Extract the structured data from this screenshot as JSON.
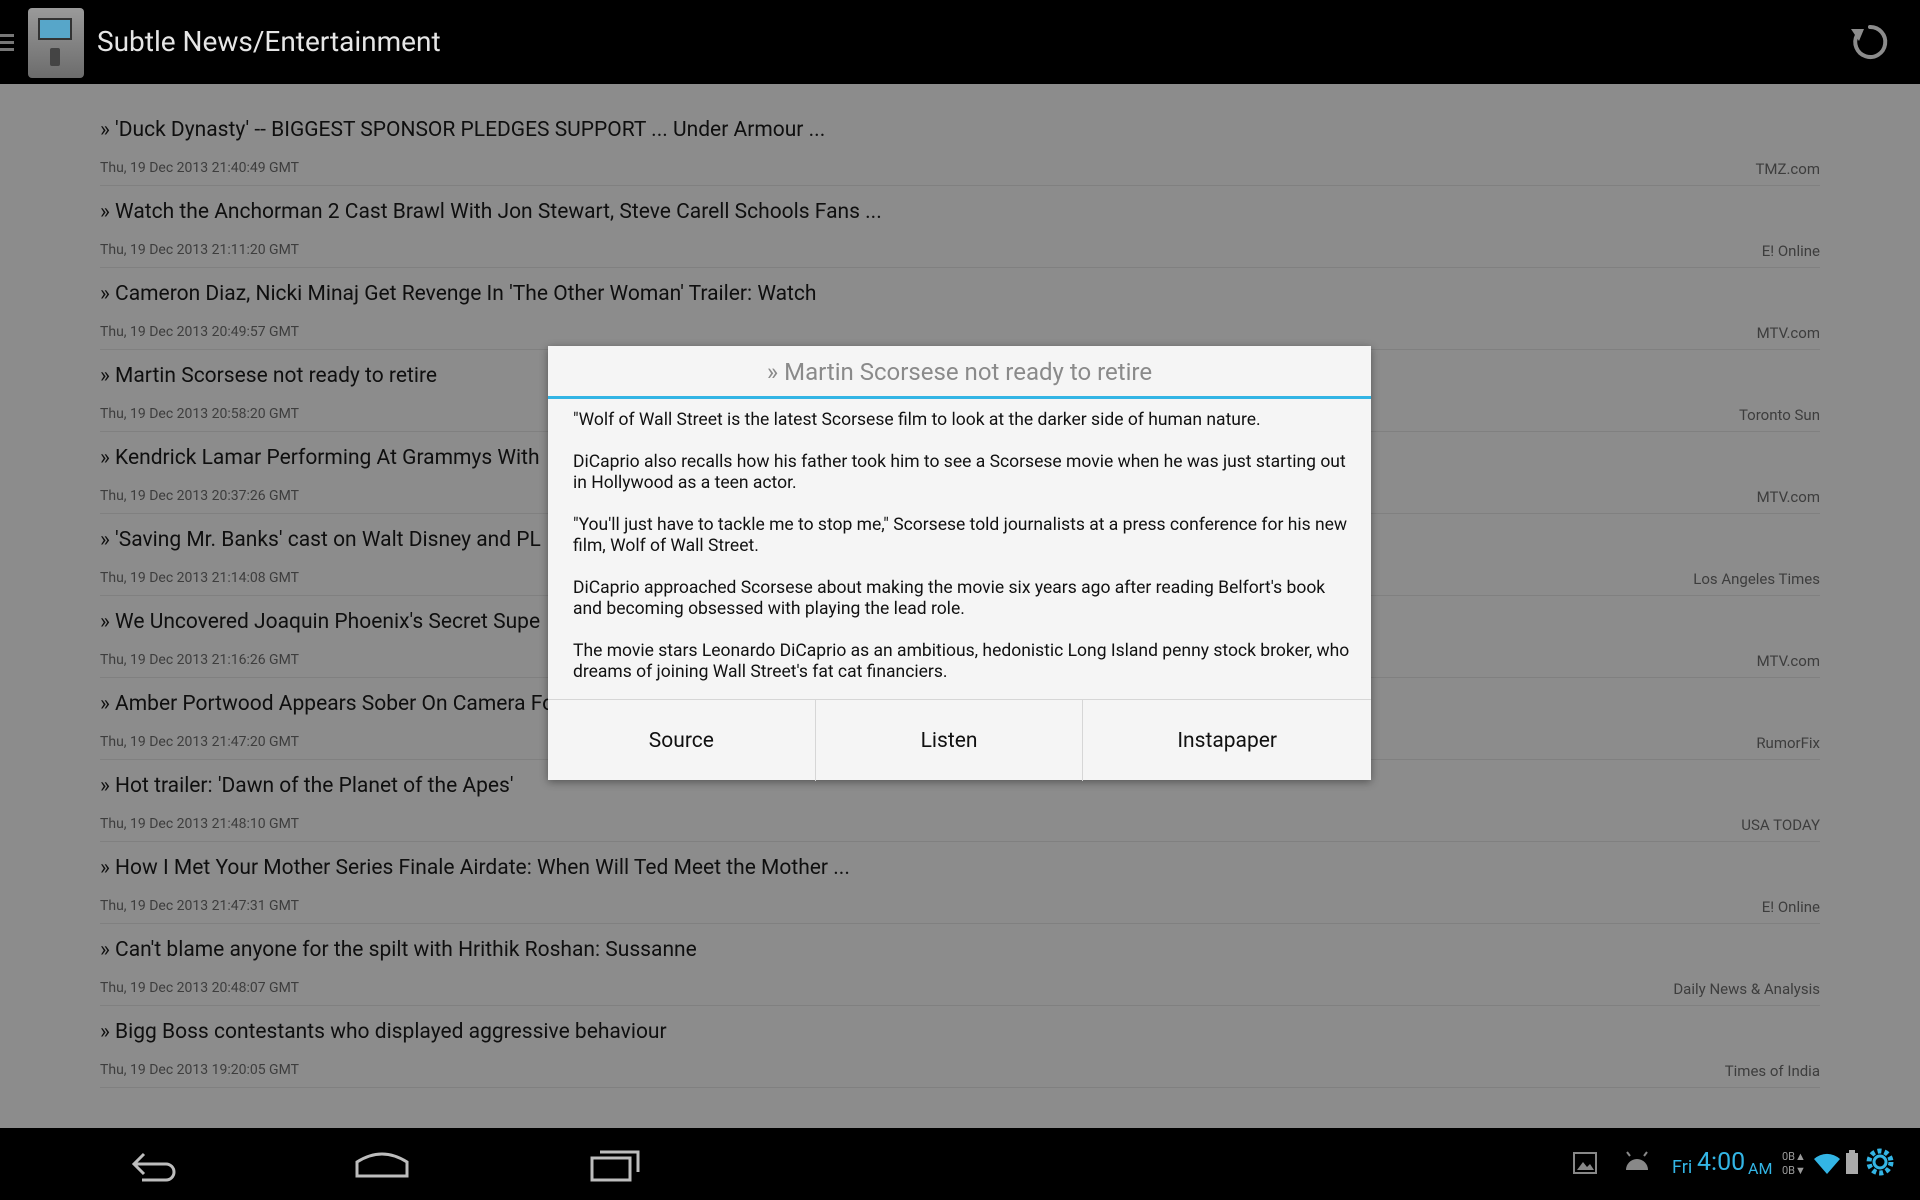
{
  "app": {
    "title": "Subtle News/Entertainment",
    "icon": "news-machine-icon",
    "refresh_icon": "refresh-icon"
  },
  "news": [
    {
      "title": "» 'Duck Dynasty' -- BIGGEST SPONSOR PLEDGES SUPPORT ... Under Armour ...",
      "date": "Thu, 19 Dec 2013 21:40:49 GMT",
      "source": "TMZ.com"
    },
    {
      "title": "» Watch the Anchorman 2 Cast Brawl With Jon Stewart, Steve Carell Schools Fans ...",
      "date": "Thu, 19 Dec 2013 21:11:20 GMT",
      "source": "E! Online"
    },
    {
      "title": "» Cameron Diaz, Nicki Minaj Get Revenge In 'The Other Woman' Trailer: Watch",
      "date": "Thu, 19 Dec 2013 20:49:57 GMT",
      "source": "MTV.com"
    },
    {
      "title": "» Martin Scorsese not ready to retire",
      "date": "Thu, 19 Dec 2013 20:58:20 GMT",
      "source": "Toronto Sun"
    },
    {
      "title": "» Kendrick Lamar Performing At Grammys With",
      "date": "Thu, 19 Dec 2013 20:37:26 GMT",
      "source": "MTV.com"
    },
    {
      "title": "» 'Saving Mr. Banks' cast on Walt Disney and PL",
      "date": "Thu, 19 Dec 2013 21:14:08 GMT",
      "source": "Los Angeles Times"
    },
    {
      "title": "» We Uncovered Joaquin Phoenix's Secret Supe",
      "date": "Thu, 19 Dec 2013 21:16:26 GMT",
      "source": "MTV.com"
    },
    {
      "title": "» Amber Portwood Appears Sober On Camera Fo",
      "date": "Thu, 19 Dec 2013 21:47:20 GMT",
      "source": "RumorFix"
    },
    {
      "title": "» Hot trailer: 'Dawn of the Planet of the Apes'",
      "date": "Thu, 19 Dec 2013 21:48:10 GMT",
      "source": "USA TODAY"
    },
    {
      "title": "» How I Met Your Mother Series Finale Airdate: When Will Ted Meet the Mother ...",
      "date": "Thu, 19 Dec 2013 21:47:31 GMT",
      "source": "E! Online"
    },
    {
      "title": "» Can't blame anyone for the spilt with Hrithik Roshan: Sussanne",
      "date": "Thu, 19 Dec 2013 20:48:07 GMT",
      "source": "Daily News & Analysis"
    },
    {
      "title": "» Bigg Boss contestants who displayed aggressive behaviour",
      "date": "Thu, 19 Dec 2013 19:20:05 GMT",
      "source": "Times of India"
    }
  ],
  "dialog": {
    "title": "» Martin Scorsese not ready to retire",
    "paragraphs": [
      "\"Wolf of Wall Street is the latest Scorsese film to look at the darker side of human nature.",
      "DiCaprio also recalls how his father took him to see a Scorsese movie when he was just starting out in Hollywood as a teen actor.",
      "\"You'll just have to tackle me to stop me,\" Scorsese told journalists at a press conference for his new film, Wolf of Wall Street.",
      "DiCaprio approached Scorsese about making the movie six years ago after reading Belfort's book and becoming obsessed with playing the lead role.",
      "The movie stars Leonardo DiCaprio as an ambitious, hedonistic Long Island penny stock broker, who dreams of joining Wall Street's fat cat financiers."
    ],
    "buttons": {
      "source": "Source",
      "listen": "Listen",
      "instapaper": "Instapaper"
    }
  },
  "status": {
    "day": "Fri",
    "time": "4:00",
    "ampm": "AM",
    "upload": "0B▲",
    "download": "0B▼"
  },
  "colors": {
    "accent": "#33b5e5",
    "action_bar": "#000000",
    "background": "#f2f2f2"
  }
}
